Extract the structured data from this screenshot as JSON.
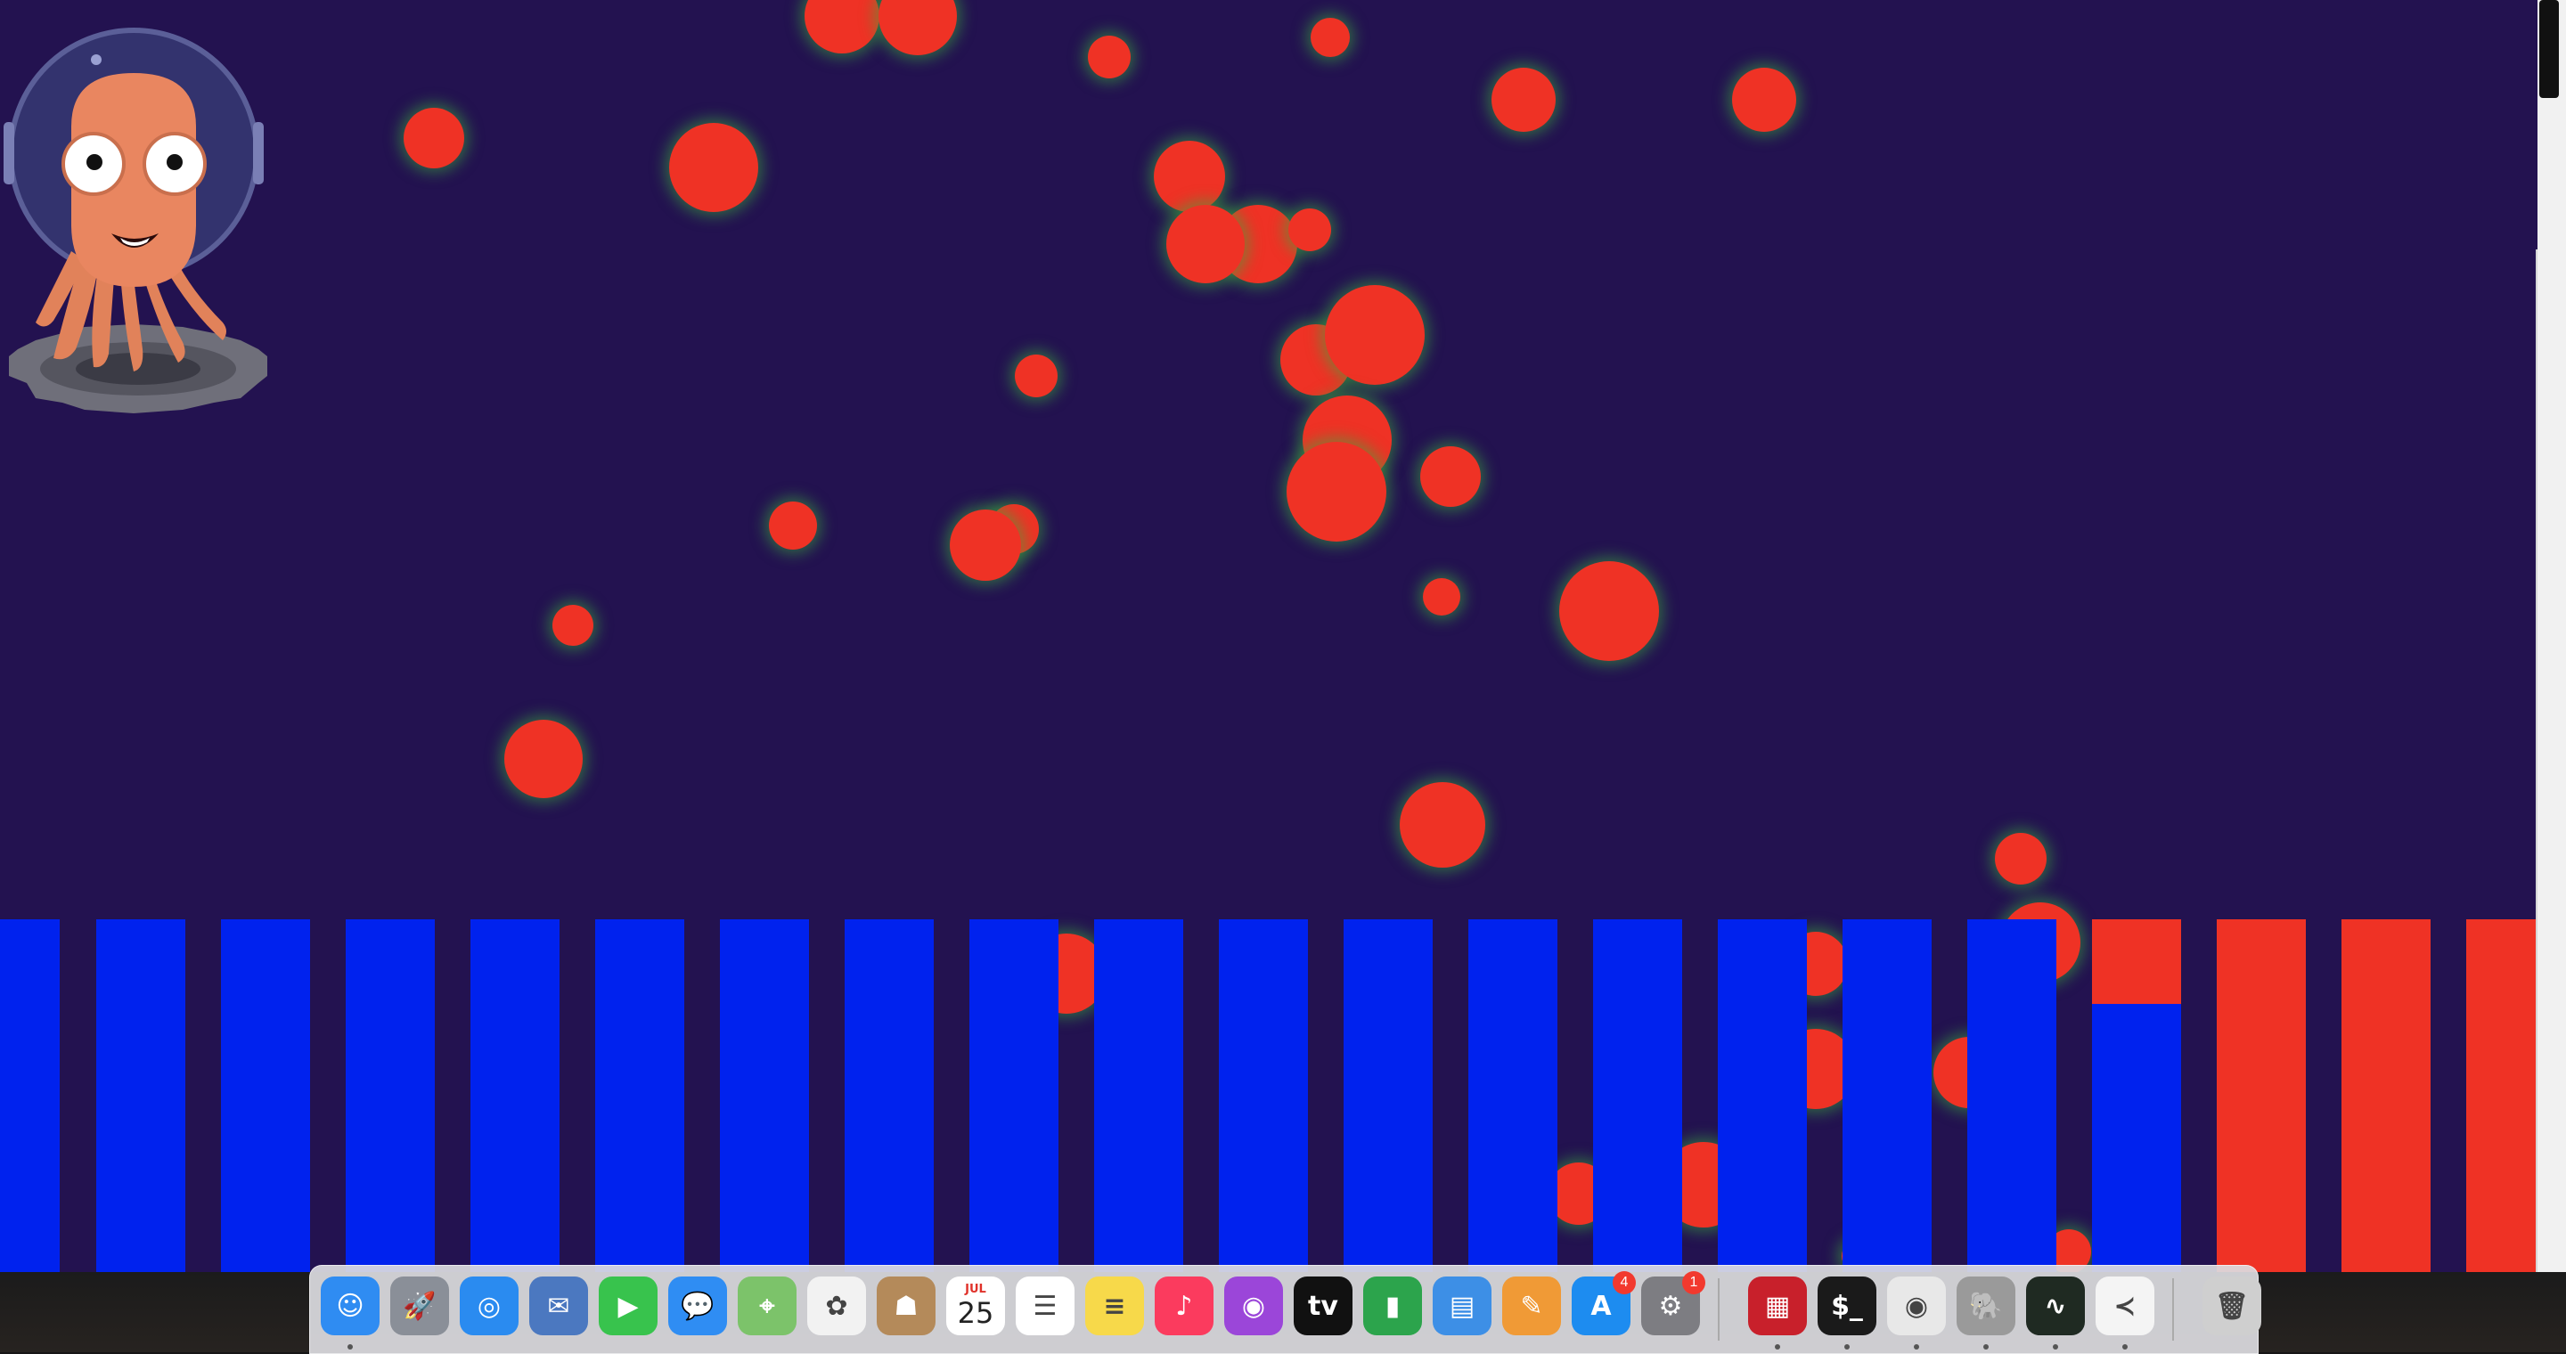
{
  "app": {
    "scene": "bubble-bars",
    "colors": {
      "background": "#231250",
      "ball": "#ef3225",
      "ball_glow": "#3caa3c",
      "bar_blue": "#0022ee",
      "bar_red": "#ef3225"
    },
    "bars": [
      {
        "blue_fraction": 1.0
      },
      {
        "blue_fraction": 1.0
      },
      {
        "blue_fraction": 1.0
      },
      {
        "blue_fraction": 1.0
      },
      {
        "blue_fraction": 1.0
      },
      {
        "blue_fraction": 1.0
      },
      {
        "blue_fraction": 1.0
      },
      {
        "blue_fraction": 1.0
      },
      {
        "blue_fraction": 1.0
      },
      {
        "blue_fraction": 1.0
      },
      {
        "blue_fraction": 1.0
      },
      {
        "blue_fraction": 1.0
      },
      {
        "blue_fraction": 1.0
      },
      {
        "blue_fraction": 1.0
      },
      {
        "blue_fraction": 1.0
      },
      {
        "blue_fraction": 1.0
      },
      {
        "blue_fraction": 1.0
      },
      {
        "blue_fraction": 0.76
      },
      {
        "blue_fraction": 0.0
      },
      {
        "blue_fraction": 0.0
      },
      {
        "blue_fraction": 0.0
      }
    ]
  },
  "mascot": {
    "icon": "argo-octopus-logo"
  },
  "dock": {
    "items": [
      {
        "name": "finder-icon",
        "color": "#2f8cf2",
        "glyph": "☺",
        "running": true
      },
      {
        "name": "launchpad-icon",
        "color": "#8a8f98",
        "glyph": "🚀",
        "running": false
      },
      {
        "name": "safari-icon",
        "color": "#2a8bf0",
        "glyph": "◎",
        "running": false
      },
      {
        "name": "mail-stamp-icon",
        "color": "#4b78c0",
        "glyph": "✉",
        "running": false
      },
      {
        "name": "facetime-icon",
        "color": "#38c34d",
        "glyph": "▶",
        "running": false
      },
      {
        "name": "messages-icon",
        "color": "#2f8df3",
        "glyph": "💬",
        "running": false
      },
      {
        "name": "maps-icon",
        "color": "#7cc36a",
        "glyph": "⌖",
        "running": false
      },
      {
        "name": "photos-icon",
        "color": "#f2f2f2",
        "glyph": "✿",
        "running": false
      },
      {
        "name": "contacts-icon",
        "color": "#b48a5a",
        "glyph": "☗",
        "running": false
      },
      {
        "name": "calendar-icon",
        "color": "#ffffff",
        "glyph": "",
        "running": false
      },
      {
        "name": "reminders-icon",
        "color": "#ffffff",
        "glyph": "☰",
        "running": false
      },
      {
        "name": "notes-icon",
        "color": "#f7d94a",
        "glyph": "≡",
        "running": false
      },
      {
        "name": "music-icon",
        "color": "#fb3b5e",
        "glyph": "♪",
        "running": false
      },
      {
        "name": "podcasts-icon",
        "color": "#9b46d9",
        "glyph": "◉",
        "running": false
      },
      {
        "name": "apple-tv-icon",
        "color": "#111111",
        "glyph": "tv",
        "running": false
      },
      {
        "name": "numbers-icon",
        "color": "#2ca44c",
        "glyph": "▮",
        "running": false
      },
      {
        "name": "keynote-icon",
        "color": "#3d8fe6",
        "glyph": "▤",
        "running": false
      },
      {
        "name": "pages-icon",
        "color": "#f09a36",
        "glyph": "✎",
        "running": false
      },
      {
        "name": "app-store-icon",
        "color": "#1d8cf0",
        "glyph": "A",
        "running": false,
        "badge": "4"
      },
      {
        "name": "system-preferences-icon",
        "color": "#7d7d82",
        "glyph": "⚙",
        "running": false,
        "badge": "1"
      },
      {
        "name": "separator"
      },
      {
        "name": "shield-app-icon",
        "color": "#c8202b",
        "glyph": "▦",
        "running": true
      },
      {
        "name": "terminal-icon",
        "color": "#1a1a1a",
        "glyph": "$_",
        "running": true
      },
      {
        "name": "chrome-icon",
        "color": "#e8e8e8",
        "glyph": "◉",
        "running": true
      },
      {
        "name": "evernote-icon",
        "color": "#9a9a9a",
        "glyph": "🐘",
        "running": true
      },
      {
        "name": "activity-monitor-icon",
        "color": "#1f2a22",
        "glyph": "∿",
        "running": true
      },
      {
        "name": "vscode-icon",
        "color": "#f4f4f4",
        "glyph": "≺",
        "running": true
      },
      {
        "name": "separator"
      },
      {
        "name": "trash-icon",
        "color": "#cfcfcf",
        "glyph": "🗑",
        "running": false
      }
    ],
    "calendar": {
      "month": "JUL",
      "day": "25"
    }
  }
}
